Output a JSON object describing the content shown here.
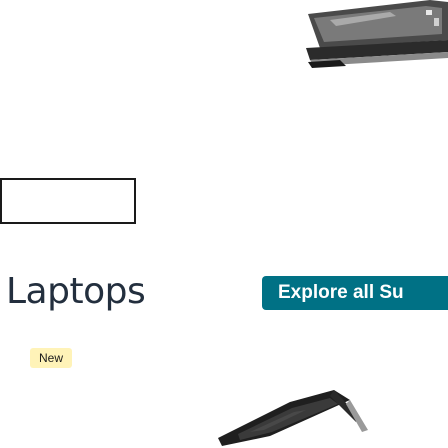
{
  "category": {
    "title": "Laptops",
    "explore_label": "Explore all Su",
    "new_badge": "New"
  },
  "images": {
    "hero": "laptop-product-image",
    "product": "laptop-product-image"
  },
  "colors": {
    "accent": "#007185",
    "title_text": "#232f3e",
    "badge_bg": "#fff3b8"
  }
}
